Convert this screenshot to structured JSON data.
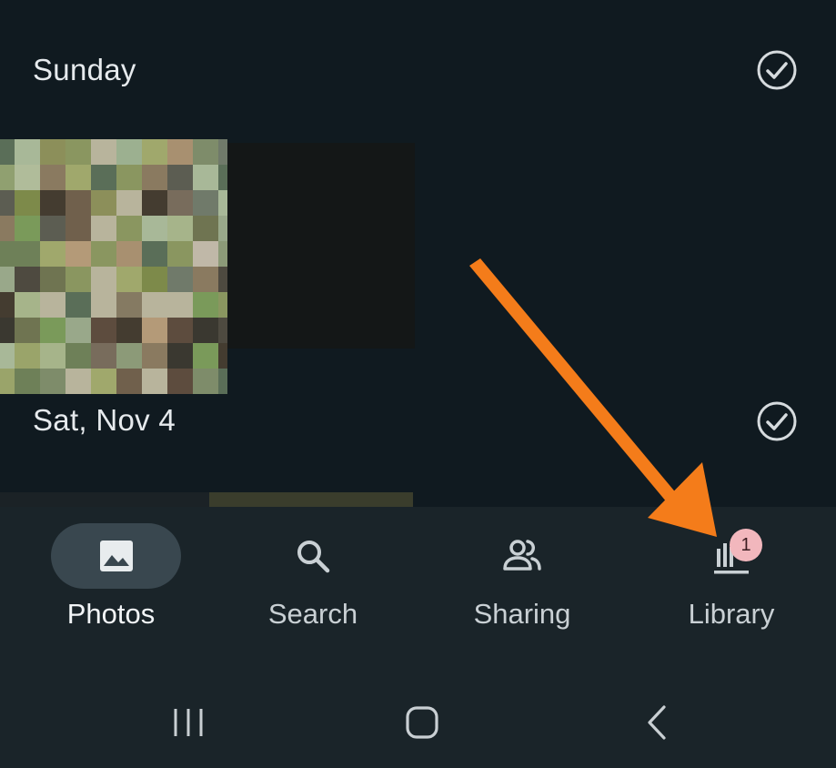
{
  "sections": [
    {
      "date": "Sunday"
    },
    {
      "date": "Sat, Nov 4"
    }
  ],
  "bottom_nav": {
    "items": [
      {
        "label": "Photos",
        "icon": "photo-icon",
        "active": true
      },
      {
        "label": "Search",
        "icon": "search-icon",
        "active": false
      },
      {
        "label": "Sharing",
        "icon": "people-icon",
        "active": false
      },
      {
        "label": "Library",
        "icon": "library-icon",
        "active": false,
        "badge": "1"
      }
    ]
  },
  "system_nav": {
    "buttons": [
      "recents-icon",
      "home-icon",
      "back-icon"
    ]
  },
  "annotation": {
    "type": "arrow",
    "color": "#f47c1a",
    "points_to": "Library"
  },
  "colors": {
    "background": "#101a20",
    "nav_background": "#1a2429",
    "active_pill": "#39474f",
    "badge": "#f2b7bd"
  }
}
